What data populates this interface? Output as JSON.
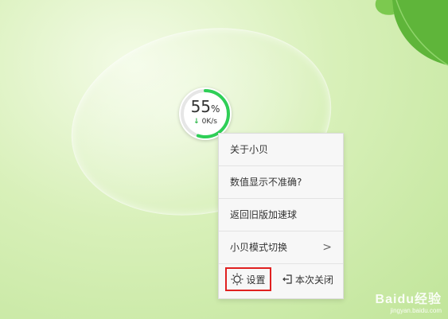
{
  "speed_ball": {
    "percent": "55",
    "percent_unit": "%",
    "speed": "0K/s",
    "ring_fraction": 0.55,
    "ring_color": "#2fcf57"
  },
  "context_menu": {
    "items": [
      {
        "label": "关于小贝"
      },
      {
        "label": "数值显示不准确?"
      },
      {
        "label": "返回旧版加速球"
      },
      {
        "label": "小贝模式切换",
        "has_submenu": true
      }
    ],
    "settings_label": "设置",
    "close_once_label": "本次关闭",
    "highlight_color": "#e02020"
  },
  "watermark": {
    "main": "Baidu经验",
    "sub": "jingyan.baidu.com"
  }
}
